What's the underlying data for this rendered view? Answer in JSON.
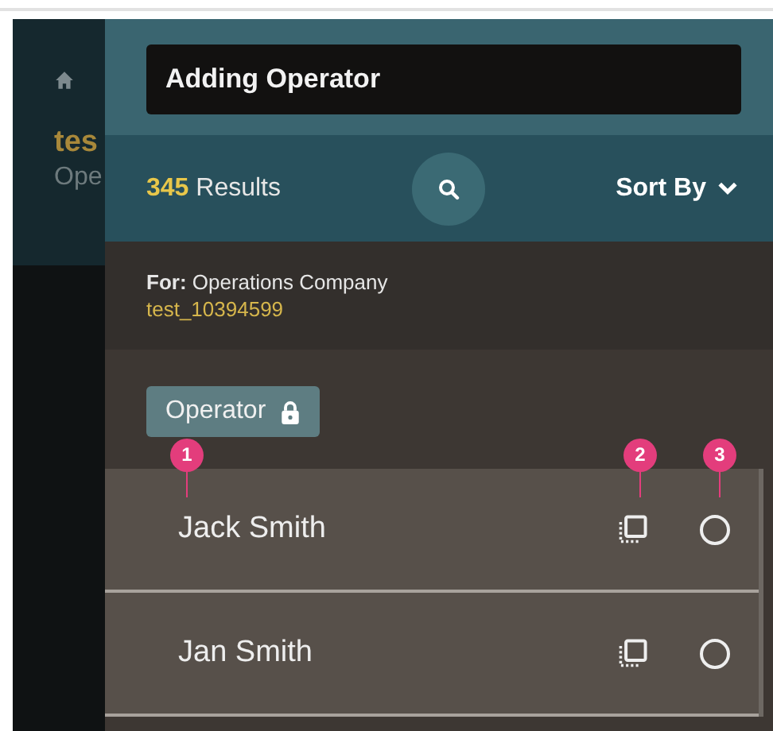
{
  "sidebar": {
    "title_partial": "tes",
    "subtitle_partial": "Ope"
  },
  "search": {
    "value": "Adding Operator"
  },
  "results": {
    "count": "345",
    "label": "Results",
    "sort_label": "Sort By"
  },
  "context": {
    "for_label": "For:",
    "company": "Operations Company",
    "id": "test_10394599"
  },
  "filter_chip": {
    "label": "Operator",
    "locked": true
  },
  "rows": [
    {
      "name": "Jack Smith",
      "selected": false
    },
    {
      "name": "Jan Smith",
      "selected": false
    }
  ],
  "callouts": [
    "1",
    "2",
    "3"
  ]
}
